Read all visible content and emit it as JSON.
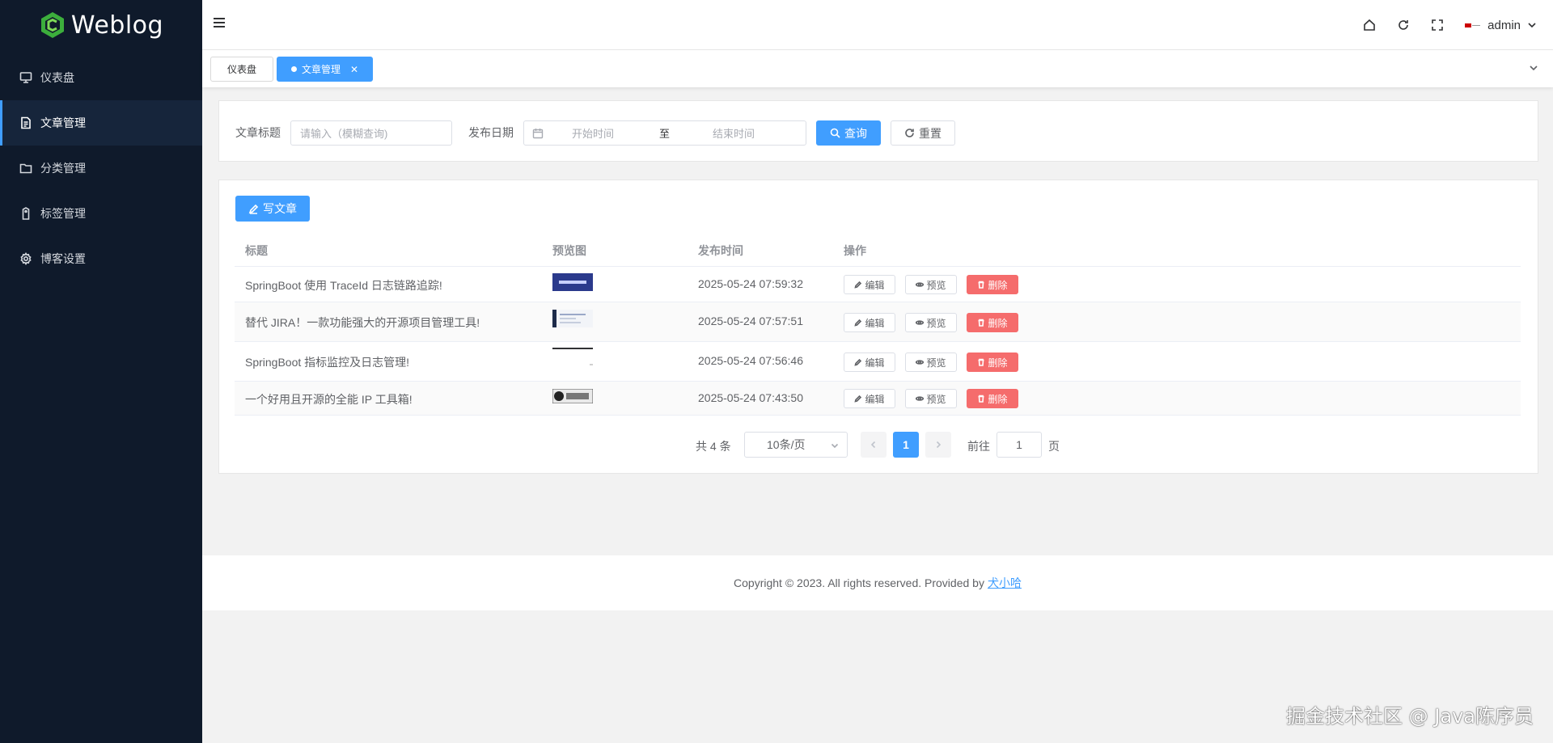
{
  "app": {
    "logo_text": "Weblog",
    "brand_color": "#409eff"
  },
  "sidebar": {
    "items": [
      {
        "label": "仪表盘",
        "icon": "monitor-icon"
      },
      {
        "label": "文章管理",
        "icon": "document-icon",
        "active": true
      },
      {
        "label": "分类管理",
        "icon": "folder-icon"
      },
      {
        "label": "标签管理",
        "icon": "tag-icon"
      },
      {
        "label": "博客设置",
        "icon": "gear-icon"
      }
    ]
  },
  "header": {
    "username": "admin"
  },
  "tabs": [
    {
      "label": "仪表盘"
    },
    {
      "label": "文章管理",
      "active": true
    }
  ],
  "search": {
    "title_label": "文章标题",
    "title_placeholder": "请输入（模糊查询)",
    "date_label": "发布日期",
    "start_placeholder": "开始时间",
    "range_separator": "至",
    "end_placeholder": "结束时间",
    "query_button": "查询",
    "reset_button": "重置"
  },
  "toolbar": {
    "write_button": "写文章"
  },
  "table": {
    "columns": [
      "标题",
      "预览图",
      "发布时间",
      "操作"
    ],
    "rows": [
      {
        "title": "SpringBoot 使用 TraceId 日志链路追踪!",
        "time": "2025-05-24 07:59:32"
      },
      {
        "title": "替代 JIRA！一款功能强大的开源项目管理工具!",
        "time": "2025-05-24 07:57:51"
      },
      {
        "title": "SpringBoot 指标监控及日志管理!",
        "time": "2025-05-24 07:56:46"
      },
      {
        "title": "一个好用且开源的全能 IP 工具箱!",
        "time": "2025-05-24 07:43:50"
      }
    ],
    "actions": {
      "edit": "编辑",
      "preview": "预览",
      "delete": "删除"
    }
  },
  "pagination": {
    "total": "共 4 条",
    "page_size": "10条/页",
    "current": "1",
    "goto_label": "前往",
    "goto_value": "1",
    "page_suffix": "页"
  },
  "footer": {
    "text": "Copyright © 2023. All rights reserved. Provided by",
    "link": "犬小哈"
  },
  "watermark": "掘金技术社区 @ Java陈序员"
}
